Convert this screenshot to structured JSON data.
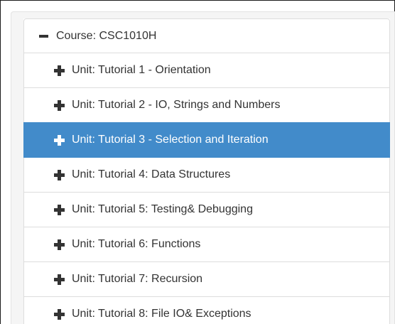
{
  "tree": {
    "root": {
      "label": "Course: CSC1010H",
      "icon": "minus-icon",
      "expanded": true
    },
    "units": [
      {
        "label": "Unit: Tutorial 1 - Orientation",
        "icon": "plus-icon",
        "selected": false
      },
      {
        "label": "Unit: Tutorial 2 - IO, Strings and Numbers",
        "icon": "plus-icon",
        "selected": false
      },
      {
        "label": "Unit: Tutorial 3 - Selection and Iteration",
        "icon": "plus-icon",
        "selected": true
      },
      {
        "label": "Unit: Tutorial 4: Data Structures",
        "icon": "plus-icon",
        "selected": false
      },
      {
        "label": "Unit: Tutorial 5: Testing& Debugging",
        "icon": "plus-icon",
        "selected": false
      },
      {
        "label": "Unit: Tutorial 6: Functions",
        "icon": "plus-icon",
        "selected": false
      },
      {
        "label": "Unit: Tutorial 7: Recursion",
        "icon": "plus-icon",
        "selected": false
      },
      {
        "label": "Unit: Tutorial 8: File IO& Exceptions",
        "icon": "plus-icon",
        "selected": false
      }
    ]
  },
  "colors": {
    "selected_background": "#428bca",
    "selected_text": "#ffffff",
    "text": "#333333",
    "border": "#dddddd",
    "panel_background": "#f5f5f5"
  }
}
